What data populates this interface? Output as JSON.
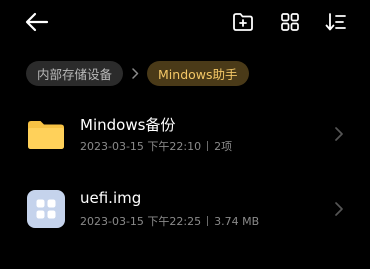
{
  "toolbar": {
    "back_icon": "arrow-left-icon",
    "new_folder_icon": "folder-plus-icon",
    "view_toggle_icon": "grid-view-icon",
    "sort_icon": "sort-icon"
  },
  "breadcrumb": {
    "items": [
      {
        "label": "内部存储设备"
      },
      {
        "label": "Mindows助手"
      }
    ],
    "current_color": "#f3c766"
  },
  "files": [
    {
      "name": "Mindows备份",
      "date": "2023-03-15 下午22:10",
      "extra": "2项",
      "icon": "folder-icon",
      "icon_color": "#f7c244"
    },
    {
      "name": "uefi.img",
      "date": "2023-03-15 下午22:25",
      "extra": "3.74 MB",
      "icon": "app-file-icon",
      "icon_color": "#c5d3ec"
    }
  ]
}
